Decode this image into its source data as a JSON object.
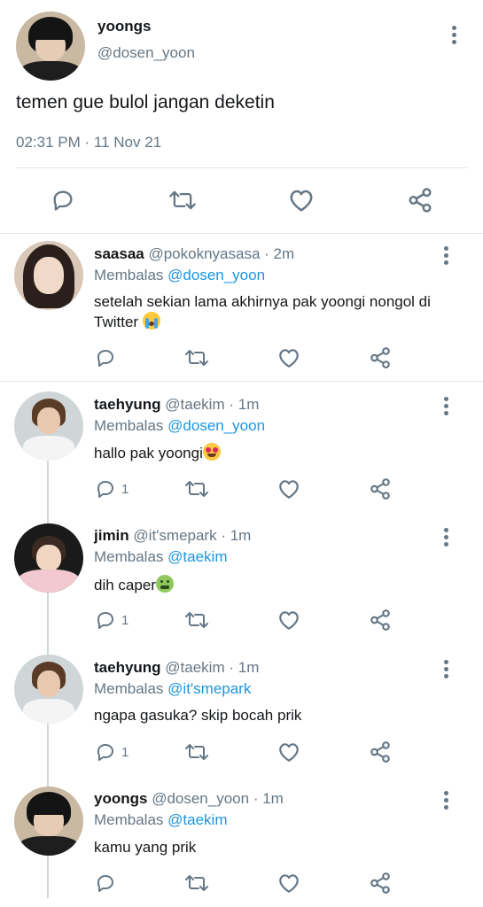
{
  "main_tweet": {
    "name": "yoongs",
    "handle": "@dosen_yoon",
    "text": "temen gue bulol jangan deketin",
    "timestamp": "02:31 PM · 11 Nov 21"
  },
  "replies": [
    {
      "name": "saasaa",
      "handle": "@pokoknyasasa",
      "time": "· 2m",
      "replying_label": "Membalas",
      "replying_to": "@dosen_yoon",
      "text": "setelah sekian lama akhirnya pak yoongi nongol di Twitter",
      "emoji": "loudly-crying-face",
      "reply_count": ""
    },
    {
      "name": "taehyung",
      "handle": "@taekim",
      "time": "· 1m",
      "replying_label": "Membalas",
      "replying_to": "@dosen_yoon",
      "text": "hallo pak yoongi",
      "emoji": "heart-eyes-face",
      "reply_count": "1"
    },
    {
      "name": "jimin",
      "handle": "@it'smepark",
      "time": "· 1m",
      "replying_label": "Membalas",
      "replying_to": "@taekim",
      "text": "dih caper",
      "emoji": "nauseated-face",
      "reply_count": "1"
    },
    {
      "name": "taehyung",
      "handle": "@taekim",
      "time": "· 1m",
      "replying_label": "Membalas",
      "replying_to": "@it'smepark",
      "text": "ngapa gasuka? skip bocah prik",
      "emoji": "",
      "reply_count": "1"
    },
    {
      "name": "yoongs",
      "handle": "@dosen_yoon",
      "time": "· 1m",
      "replying_label": "Membalas",
      "replying_to": "@taekim",
      "text": "kamu yang prik",
      "emoji": "",
      "reply_count": ""
    }
  ],
  "colors": {
    "link": "#1b95e0",
    "muted": "#657786",
    "divider": "#e1e8ed"
  }
}
